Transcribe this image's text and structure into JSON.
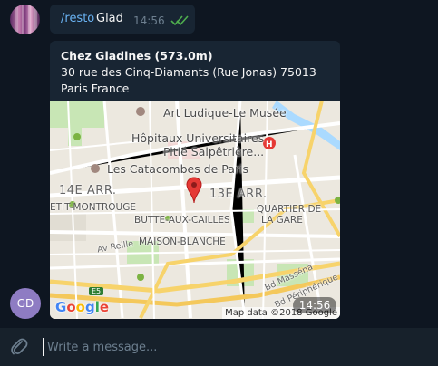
{
  "command_message": {
    "command": "/resto",
    "argument": "Glad",
    "time": "14:56",
    "status": "read"
  },
  "venue_message": {
    "title": "Chez Gladines (573.0m)",
    "address_line1": "30 rue des Cinq-Diamants (Rue Jonas) 75013",
    "address_line2": "Paris France",
    "time": "14:56",
    "map": {
      "labels": {
        "museum": "Art Ludique-Le Musée",
        "hospital_1": "Hôpitaux Universitaires",
        "hospital_2": "Pitié Salpêtrière...",
        "catacombs": "Les Catacombes de Paris",
        "arr14": "14E ARR.",
        "arr13": "13E ARR.",
        "montrouge": "ETIT-MONTROUGE",
        "quartier_1": "QUARTIER DE",
        "quartier_2": "LA GARE",
        "butte": "BUTTE-AUX-CAILLES",
        "maison": "MAISON-BLANCHE",
        "av_reille": "Av Reille",
        "bd_massena": "Bd Masséna",
        "bd_periph": "Bd Périphérique",
        "route": "E5"
      },
      "logo": "Google",
      "credit": "Map data ©2018 Google",
      "pin_color": "#e53935"
    }
  },
  "sender_avatar": {
    "initials": "GD",
    "color": "#8e7cc3"
  },
  "composer": {
    "placeholder": "Write a message..."
  },
  "icons": {
    "attach": "paperclip-icon",
    "read_status": "double-check-icon",
    "pin": "map-pin-icon"
  }
}
